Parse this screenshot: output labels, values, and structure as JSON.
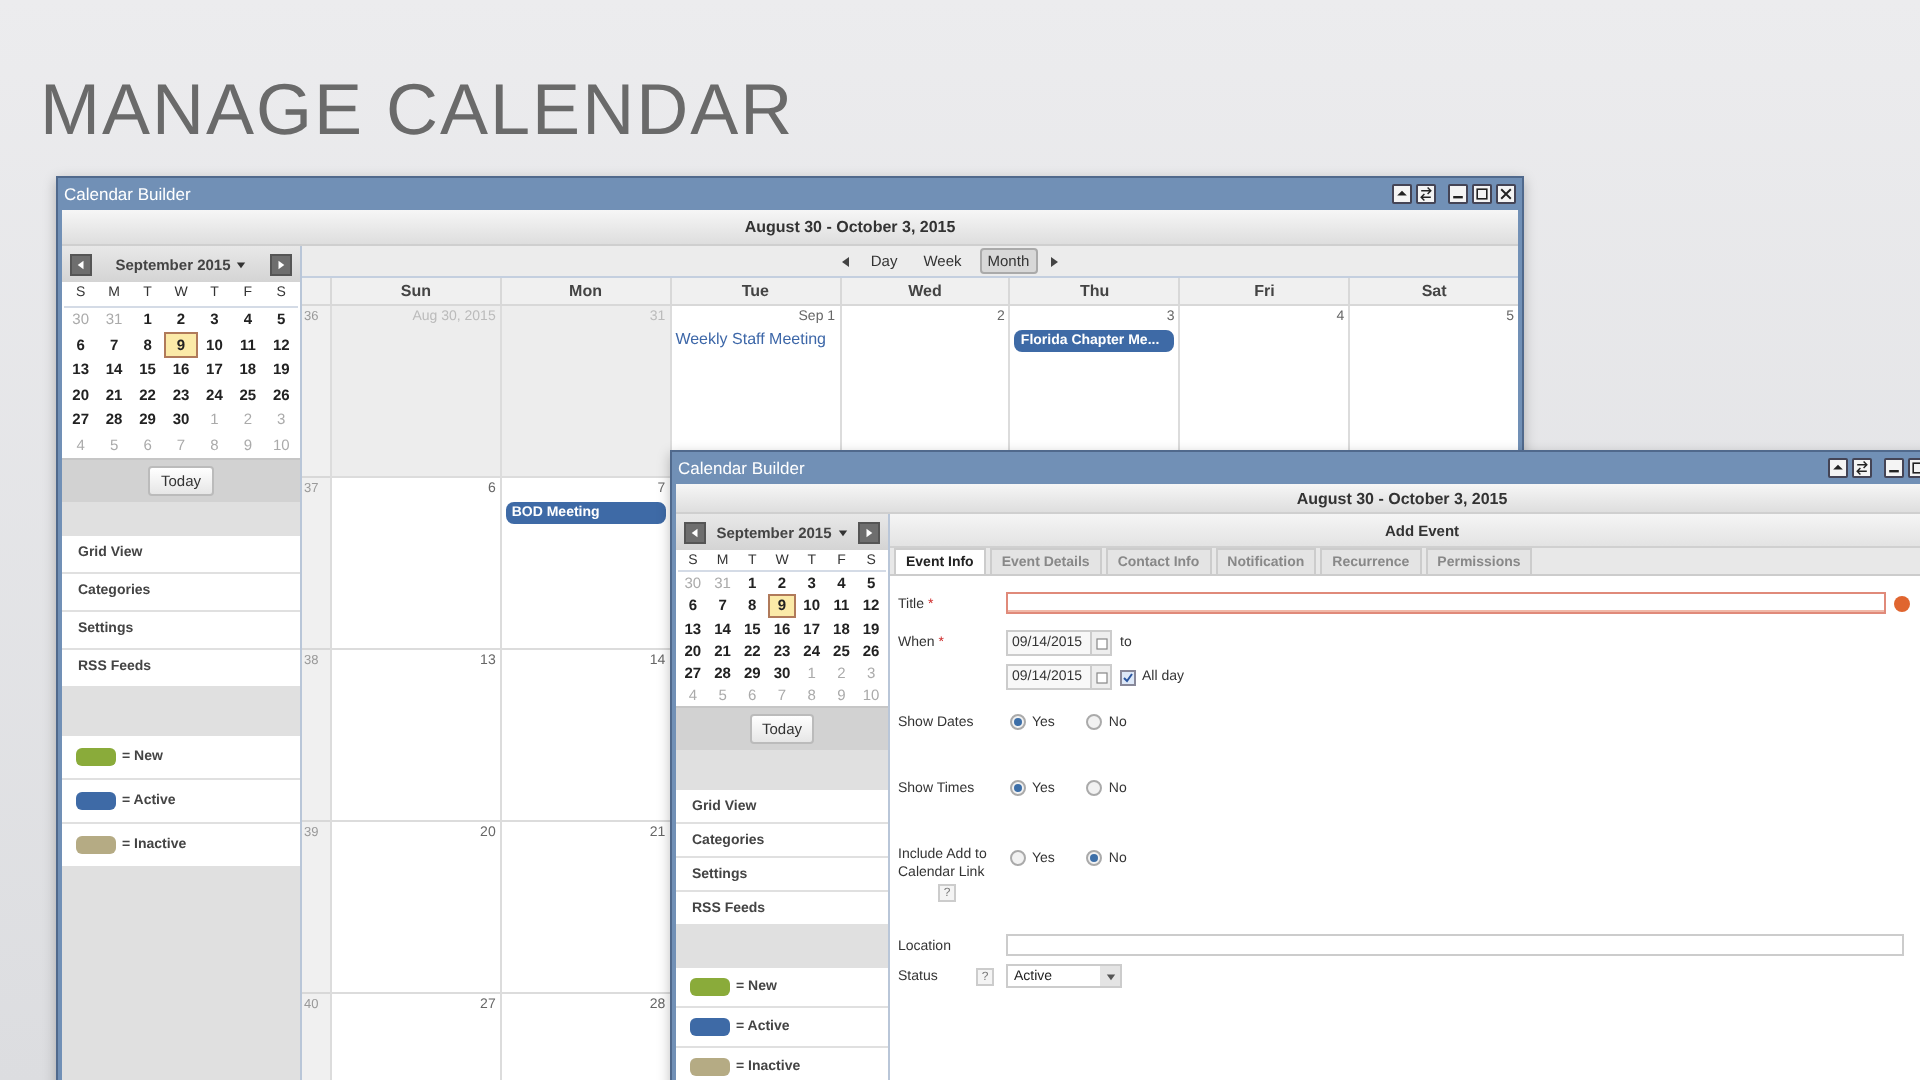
{
  "slide_title": "MANAGE CALENDAR",
  "calendar_window": {
    "title": "Calendar Builder",
    "range": "August 30 - October 3, 2015",
    "mini_calendar": {
      "month": "September 2015",
      "weekdays": [
        "S",
        "M",
        "T",
        "W",
        "T",
        "F",
        "S"
      ],
      "weeks": [
        [
          {
            "label": "30",
            "other_month": true,
            "selected": false
          },
          {
            "label": "31",
            "other_month": true,
            "selected": false
          },
          {
            "label": "1",
            "other_month": false,
            "selected": false
          },
          {
            "label": "2",
            "other_month": false,
            "selected": false
          },
          {
            "label": "3",
            "other_month": false,
            "selected": false
          },
          {
            "label": "4",
            "other_month": false,
            "selected": false
          },
          {
            "label": "5",
            "other_month": false,
            "selected": false
          }
        ],
        [
          {
            "label": "6",
            "other_month": false,
            "selected": false
          },
          {
            "label": "7",
            "other_month": false,
            "selected": false
          },
          {
            "label": "8",
            "other_month": false,
            "selected": false
          },
          {
            "label": "9",
            "other_month": false,
            "selected": true
          },
          {
            "label": "10",
            "other_month": false,
            "selected": false
          },
          {
            "label": "11",
            "other_month": false,
            "selected": false
          },
          {
            "label": "12",
            "other_month": false,
            "selected": false
          }
        ],
        [
          {
            "label": "13",
            "other_month": false,
            "selected": false
          },
          {
            "label": "14",
            "other_month": false,
            "selected": false
          },
          {
            "label": "15",
            "other_month": false,
            "selected": false
          },
          {
            "label": "16",
            "other_month": false,
            "selected": false
          },
          {
            "label": "17",
            "other_month": false,
            "selected": false
          },
          {
            "label": "18",
            "other_month": false,
            "selected": false
          },
          {
            "label": "19",
            "other_month": false,
            "selected": false
          }
        ],
        [
          {
            "label": "20",
            "other_month": false,
            "selected": false
          },
          {
            "label": "21",
            "other_month": false,
            "selected": false
          },
          {
            "label": "22",
            "other_month": false,
            "selected": false
          },
          {
            "label": "23",
            "other_month": false,
            "selected": false
          },
          {
            "label": "24",
            "other_month": false,
            "selected": false
          },
          {
            "label": "25",
            "other_month": false,
            "selected": false
          },
          {
            "label": "26",
            "other_month": false,
            "selected": false
          }
        ],
        [
          {
            "label": "27",
            "other_month": false,
            "selected": false
          },
          {
            "label": "28",
            "other_month": false,
            "selected": false
          },
          {
            "label": "29",
            "other_month": false,
            "selected": false
          },
          {
            "label": "30",
            "other_month": false,
            "selected": false
          },
          {
            "label": "1",
            "other_month": true,
            "selected": false
          },
          {
            "label": "2",
            "other_month": true,
            "selected": false
          },
          {
            "label": "3",
            "other_month": true,
            "selected": false
          }
        ],
        [
          {
            "label": "4",
            "other_month": true,
            "selected": false
          },
          {
            "label": "5",
            "other_month": true,
            "selected": false
          },
          {
            "label": "6",
            "other_month": true,
            "selected": false
          },
          {
            "label": "7",
            "other_month": true,
            "selected": false
          },
          {
            "label": "8",
            "other_month": true,
            "selected": false
          },
          {
            "label": "9",
            "other_month": true,
            "selected": false
          },
          {
            "label": "10",
            "other_month": true,
            "selected": false
          }
        ]
      ]
    },
    "today_button": "Today",
    "nav_items": [
      "Grid View",
      "Categories",
      "Settings",
      "RSS Feeds"
    ],
    "legend": [
      {
        "label": "= New",
        "color": "#8aab3a"
      },
      {
        "label": "= Active",
        "color": "#3e6aa6"
      },
      {
        "label": "= Inactive",
        "color": "#b5ab84"
      }
    ],
    "views": [
      {
        "label": "Day",
        "selected": false
      },
      {
        "label": "Week",
        "selected": false
      },
      {
        "label": "Month",
        "selected": true
      }
    ],
    "weekdays": [
      "Sun",
      "Mon",
      "Tue",
      "Wed",
      "Thu",
      "Fri",
      "Sat"
    ],
    "weeks": [
      {
        "number": "36",
        "days": [
          {
            "label": "Aug 30, 2015",
            "other_month": true
          },
          {
            "label": "31",
            "other_month": true
          },
          {
            "label": "Sep 1",
            "other_month": false,
            "events": [
              {
                "kind": "text",
                "title": "Weekly Staff Meeting"
              }
            ]
          },
          {
            "label": "2",
            "other_month": false
          },
          {
            "label": "3",
            "other_month": false,
            "events": [
              {
                "kind": "pill",
                "title": "Florida Chapter Me...",
                "color": "#3e6aa6"
              }
            ]
          },
          {
            "label": "4",
            "other_month": false
          },
          {
            "label": "5",
            "other_month": false
          }
        ]
      },
      {
        "number": "37",
        "days": [
          {
            "label": "6",
            "other_month": false
          },
          {
            "label": "7",
            "other_month": false,
            "events": [
              {
                "kind": "pill",
                "title": "BOD Meeting",
                "color": "#3e6aa6"
              }
            ]
          }
        ]
      },
      {
        "number": "38",
        "days": [
          {
            "label": "13",
            "other_month": false
          },
          {
            "label": "14",
            "other_month": false
          }
        ]
      },
      {
        "number": "39",
        "days": [
          {
            "label": "20",
            "other_month": false
          },
          {
            "label": "21",
            "other_month": false
          }
        ]
      },
      {
        "number": "40",
        "days": [
          {
            "label": "27",
            "other_month": false
          },
          {
            "label": "28",
            "other_month": false
          }
        ]
      }
    ]
  },
  "event_window": {
    "title": "Calendar Builder",
    "range": "August 30 - October 3, 2015",
    "mini_calendar": {
      "month": "September 2015",
      "weekdays": [
        "S",
        "M",
        "T",
        "W",
        "T",
        "F",
        "S"
      ],
      "weeks": [
        [
          {
            "label": "30",
            "other_month": true,
            "selected": false
          },
          {
            "label": "31",
            "other_month": true,
            "selected": false
          },
          {
            "label": "1",
            "other_month": false,
            "selected": false
          },
          {
            "label": "2",
            "other_month": false,
            "selected": false
          },
          {
            "label": "3",
            "other_month": false,
            "selected": false
          },
          {
            "label": "4",
            "other_month": false,
            "selected": false
          },
          {
            "label": "5",
            "other_month": false,
            "selected": false
          }
        ],
        [
          {
            "label": "6",
            "other_month": false,
            "selected": false
          },
          {
            "label": "7",
            "other_month": false,
            "selected": false
          },
          {
            "label": "8",
            "other_month": false,
            "selected": false
          },
          {
            "label": "9",
            "other_month": false,
            "selected": true
          },
          {
            "label": "10",
            "other_month": false,
            "selected": false
          },
          {
            "label": "11",
            "other_month": false,
            "selected": false
          },
          {
            "label": "12",
            "other_month": false,
            "selected": false
          }
        ],
        [
          {
            "label": "13",
            "other_month": false,
            "selected": false
          },
          {
            "label": "14",
            "other_month": false,
            "selected": false
          },
          {
            "label": "15",
            "other_month": false,
            "selected": false
          },
          {
            "label": "16",
            "other_month": false,
            "selected": false
          },
          {
            "label": "17",
            "other_month": false,
            "selected": false
          },
          {
            "label": "18",
            "other_month": false,
            "selected": false
          },
          {
            "label": "19",
            "other_month": false,
            "selected": false
          }
        ],
        [
          {
            "label": "20",
            "other_month": false,
            "selected": false
          },
          {
            "label": "21",
            "other_month": false,
            "selected": false
          },
          {
            "label": "22",
            "other_month": false,
            "selected": false
          },
          {
            "label": "23",
            "other_month": false,
            "selected": false
          },
          {
            "label": "24",
            "other_month": false,
            "selected": false
          },
          {
            "label": "25",
            "other_month": false,
            "selected": false
          },
          {
            "label": "26",
            "other_month": false,
            "selected": false
          }
        ],
        [
          {
            "label": "27",
            "other_month": false,
            "selected": false
          },
          {
            "label": "28",
            "other_month": false,
            "selected": false
          },
          {
            "label": "29",
            "other_month": false,
            "selected": false
          },
          {
            "label": "30",
            "other_month": false,
            "selected": false
          },
          {
            "label": "1",
            "other_month": true,
            "selected": false
          },
          {
            "label": "2",
            "other_month": true,
            "selected": false
          },
          {
            "label": "3",
            "other_month": true,
            "selected": false
          }
        ],
        [
          {
            "label": "4",
            "other_month": true,
            "selected": false
          },
          {
            "label": "5",
            "other_month": true,
            "selected": false
          },
          {
            "label": "6",
            "other_month": true,
            "selected": false
          },
          {
            "label": "7",
            "other_month": true,
            "selected": false
          },
          {
            "label": "8",
            "other_month": true,
            "selected": false
          },
          {
            "label": "9",
            "other_month": true,
            "selected": false
          },
          {
            "label": "10",
            "other_month": true,
            "selected": false
          }
        ]
      ]
    },
    "today_button": "Today",
    "nav_items": [
      "Grid View",
      "Categories",
      "Settings",
      "RSS Feeds"
    ],
    "legend": [
      {
        "label": "= New",
        "color": "#8aab3a"
      },
      {
        "label": "= Active",
        "color": "#3e6aa6"
      },
      {
        "label": "= Inactive",
        "color": "#b5ab84"
      }
    ],
    "panel_title": "Add Event",
    "tabs": [
      {
        "label": "Event Info",
        "selected": true
      },
      {
        "label": "Event Details",
        "selected": false
      },
      {
        "label": "Contact Info",
        "selected": false
      },
      {
        "label": "Notification",
        "selected": false
      },
      {
        "label": "Recurrence",
        "selected": false
      },
      {
        "label": "Permissions",
        "selected": false
      }
    ],
    "fields": [
      {
        "kind": "text",
        "label": "Title",
        "required_mark": "*",
        "error": true
      },
      {
        "kind": "date_range",
        "label": "When",
        "required_mark": "*",
        "start": "09/14/2015",
        "to_label": "to",
        "end": "09/14/2015",
        "all_day": {
          "label": "All day",
          "checked": true
        }
      },
      {
        "kind": "radio",
        "label": "Show Dates",
        "options": [
          {
            "label": "Yes",
            "selected": true
          },
          {
            "label": "No",
            "selected": false
          }
        ]
      },
      {
        "kind": "radio",
        "label": "Show Times",
        "options": [
          {
            "label": "Yes",
            "selected": true
          },
          {
            "label": "No",
            "selected": false
          }
        ]
      },
      {
        "kind": "radio",
        "label": "Include Add to Calendar Link",
        "help": "?",
        "options": [
          {
            "label": "Yes",
            "selected": false
          },
          {
            "label": "No",
            "selected": true
          }
        ]
      },
      {
        "kind": "text",
        "label": "Location",
        "error": false
      },
      {
        "kind": "select",
        "label": "Status",
        "help": "?",
        "value": "Active"
      }
    ]
  }
}
